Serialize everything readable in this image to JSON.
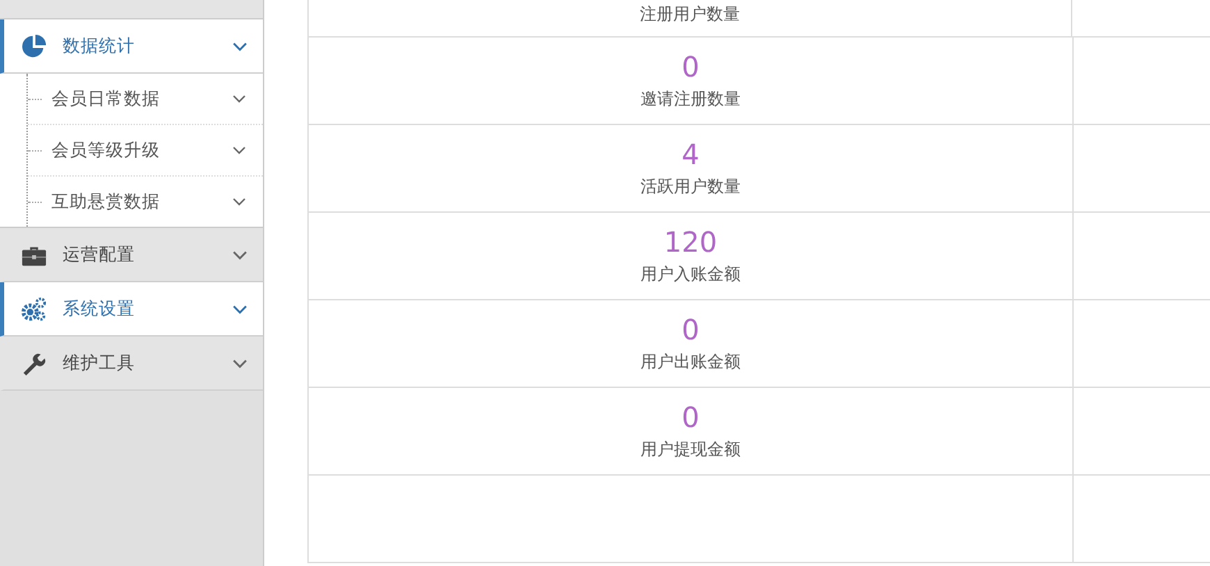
{
  "sidebar": {
    "items": [
      {
        "label": "数据统计",
        "active": true,
        "children": [
          {
            "label": "会员日常数据"
          },
          {
            "label": "会员等级升级"
          },
          {
            "label": "互助悬赏数据"
          }
        ]
      },
      {
        "label": "运营配置",
        "active": false
      },
      {
        "label": "系统设置",
        "active": true
      },
      {
        "label": "维护工具",
        "active": false
      }
    ]
  },
  "stats": [
    {
      "label": "注册用户数量"
    },
    {
      "value": "0",
      "label": "邀请注册数量"
    },
    {
      "value": "4",
      "label": "活跃用户数量"
    },
    {
      "value": "120",
      "label": "用户入账金额"
    },
    {
      "value": "0",
      "label": "用户出账金额"
    },
    {
      "value": "0",
      "label": "用户提现金额"
    }
  ]
}
